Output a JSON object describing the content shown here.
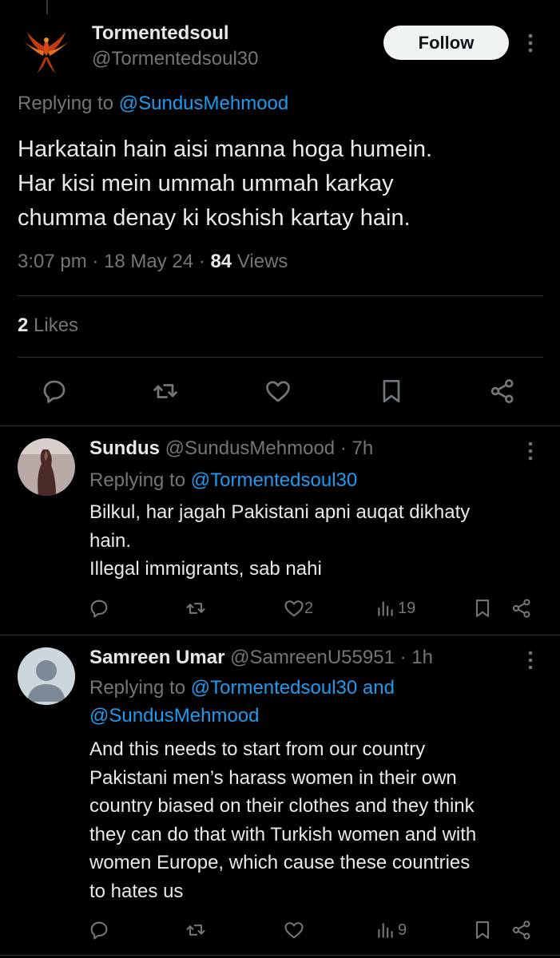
{
  "main_tweet": {
    "name": "Tormentedsoul",
    "handle": "@Tormentedsoul30",
    "follow_label": "Follow",
    "replying_prefix": "Replying to ",
    "replying_to": "@SundusMehmood",
    "text_lines": [
      "Harkatain hain aisi manna hoga humein.",
      "Har kisi mein ummah ummah karkay",
      "chumma denay ki koshish kartay hain."
    ],
    "time": "3:07 pm",
    "date": "18 May 24",
    "views_count": "84",
    "views_label": "Views",
    "likes_count": "2",
    "likes_label": "Likes"
  },
  "replies": [
    {
      "name": "Sundus",
      "handle": "@SundusMehmood",
      "age": "7h",
      "replying_prefix": "Replying to ",
      "replying_to_line1": "@Tormentedsoul30",
      "text_lines": [
        "Bilkul, har jagah Pakistani apni auqat dikhaty",
        "hain.",
        "Illegal immigrants, sab nahi"
      ],
      "likes": "2",
      "views": "19"
    },
    {
      "name": "Samreen Umar",
      "handle": "@SamreenU55951",
      "age": "1h",
      "replying_prefix": "Replying to ",
      "replying_to_line1": "@Tormentedsoul30 and",
      "replying_to_line2": "@SundusMehmood",
      "text_lines": [
        "And this needs to start from our country",
        "Pakistani men’s harass women in their own",
        "country biased on their clothes and they think",
        "they can do that with Turkish women and with",
        "women Europe, which cause these countries",
        "to hates us"
      ],
      "views": "9"
    }
  ],
  "colors": {
    "background": "#000000",
    "text": "#e7e9ea",
    "muted": "#71767b",
    "link": "#1d9bf0",
    "divider": "#2f3336"
  },
  "icons": [
    "phoenix-avatar",
    "more-icon",
    "reply-icon",
    "retweet-icon",
    "like-icon",
    "bookmark-icon",
    "share-icon",
    "views-icon"
  ]
}
